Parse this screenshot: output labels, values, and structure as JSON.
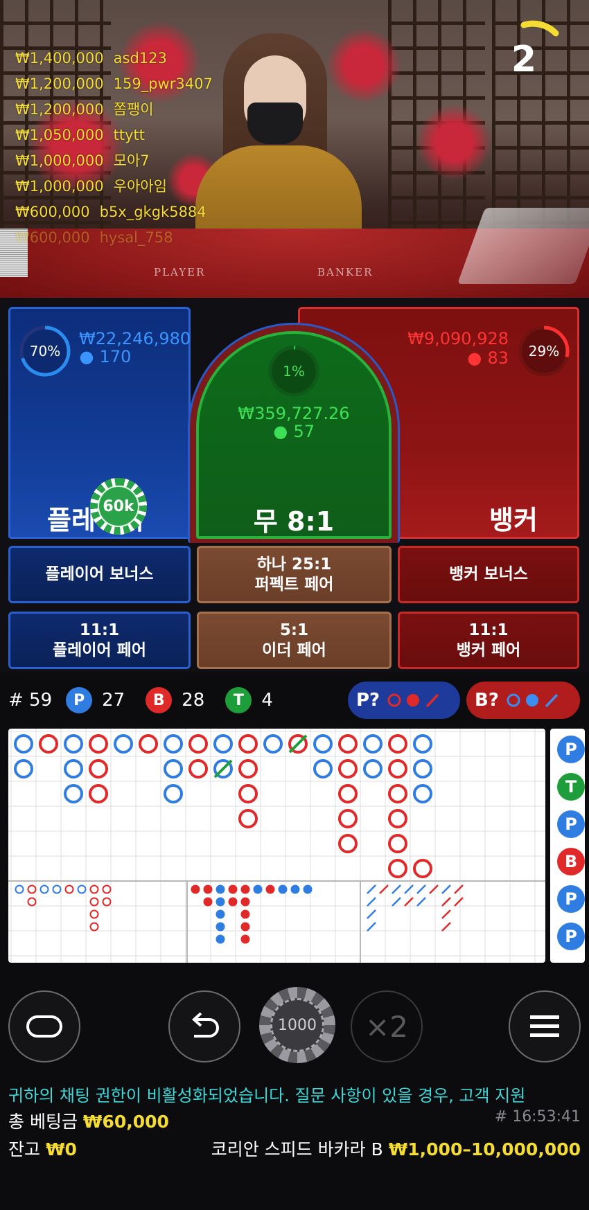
{
  "video": {
    "table_player_label": "PLAYER",
    "table_banker_label": "BANKER",
    "countdown": "2",
    "bet_feed": [
      {
        "amount": "₩1,400,000",
        "user": "asd123"
      },
      {
        "amount": "₩1,200,000",
        "user": "159_pwr3407"
      },
      {
        "amount": "₩1,200,000",
        "user": "쫌팽이"
      },
      {
        "amount": "₩1,050,000",
        "user": "ttytt"
      },
      {
        "amount": "₩1,000,000",
        "user": "모아7"
      },
      {
        "amount": "₩1,000,000",
        "user": "우아아임"
      },
      {
        "amount": "₩600,000",
        "user": "b5x_gkgk5884"
      },
      {
        "amount": "₩600,000",
        "user": "hysal_758"
      }
    ]
  },
  "zones": {
    "player": {
      "percent": "70%",
      "percent_value": 0.7,
      "amount": "₩22,246,980",
      "players": "170",
      "label": "플레이어",
      "color": "#2b8cf0"
    },
    "tie": {
      "percent": "1%",
      "percent_value": 0.01,
      "amount": "₩359,727.26",
      "players": "57",
      "label": "무 8:1",
      "color": "#2fd34a"
    },
    "banker": {
      "percent": "29%",
      "percent_value": 0.29,
      "amount": "₩9,090,928",
      "players": "83",
      "label": "뱅커",
      "color": "#ff3030"
    },
    "chip": "60k"
  },
  "side_bets": {
    "player_bonus": "플레이어 보너스",
    "perfect_pair_line1": "하나 25:1",
    "perfect_pair_line2": "퍼펙트 페어",
    "banker_bonus": "뱅커 보너스",
    "player_pair_line1": "11:1",
    "player_pair_line2": "플레이어 페어",
    "either_pair_line1": "5:1",
    "either_pair_line2": "이더 페어",
    "banker_pair_line1": "11:1",
    "banker_pair_line2": "뱅커 페어"
  },
  "stats": {
    "round": "# 59",
    "p_label": "P",
    "p_count": "27",
    "b_label": "B",
    "b_count": "28",
    "t_label": "T",
    "t_count": "4",
    "p_predict": "P?",
    "b_predict": "B?",
    "colors": {
      "player": "#2f7de0",
      "banker": "#e02a2a",
      "tie": "#1e9e3a"
    }
  },
  "roadmap": {
    "big_road": [
      {
        "col": 0,
        "row": 0,
        "c": "B"
      },
      {
        "col": 0,
        "row": 1,
        "c": "B"
      },
      {
        "col": 1,
        "row": 0,
        "c": "R"
      },
      {
        "col": 2,
        "row": 0,
        "c": "B"
      },
      {
        "col": 2,
        "row": 1,
        "c": "B"
      },
      {
        "col": 2,
        "row": 2,
        "c": "B"
      },
      {
        "col": 3,
        "row": 0,
        "c": "R"
      },
      {
        "col": 3,
        "row": 1,
        "c": "R"
      },
      {
        "col": 3,
        "row": 2,
        "c": "R"
      },
      {
        "col": 4,
        "row": 0,
        "c": "B"
      },
      {
        "col": 5,
        "row": 0,
        "c": "R"
      },
      {
        "col": 6,
        "row": 0,
        "c": "B"
      },
      {
        "col": 6,
        "row": 1,
        "c": "B"
      },
      {
        "col": 6,
        "row": 2,
        "c": "B"
      },
      {
        "col": 7,
        "row": 0,
        "c": "R"
      },
      {
        "col": 7,
        "row": 1,
        "c": "R"
      },
      {
        "col": 8,
        "row": 0,
        "c": "B"
      },
      {
        "col": 8,
        "row": 1,
        "c": "B",
        "tie": true
      },
      {
        "col": 9,
        "row": 0,
        "c": "R"
      },
      {
        "col": 9,
        "row": 1,
        "c": "R"
      },
      {
        "col": 9,
        "row": 2,
        "c": "R"
      },
      {
        "col": 9,
        "row": 3,
        "c": "R"
      },
      {
        "col": 10,
        "row": 0,
        "c": "B"
      },
      {
        "col": 11,
        "row": 0,
        "c": "R",
        "tie": true
      },
      {
        "col": 12,
        "row": 0,
        "c": "B"
      },
      {
        "col": 12,
        "row": 1,
        "c": "B"
      },
      {
        "col": 13,
        "row": 0,
        "c": "R"
      },
      {
        "col": 13,
        "row": 1,
        "c": "R"
      },
      {
        "col": 13,
        "row": 2,
        "c": "R"
      },
      {
        "col": 13,
        "row": 3,
        "c": "R"
      },
      {
        "col": 13,
        "row": 4,
        "c": "R"
      },
      {
        "col": 14,
        "row": 0,
        "c": "B"
      },
      {
        "col": 14,
        "row": 1,
        "c": "B"
      },
      {
        "col": 15,
        "row": 0,
        "c": "R"
      },
      {
        "col": 15,
        "row": 1,
        "c": "R"
      },
      {
        "col": 15,
        "row": 2,
        "c": "R"
      },
      {
        "col": 15,
        "row": 3,
        "c": "R"
      },
      {
        "col": 15,
        "row": 4,
        "c": "R"
      },
      {
        "col": 15,
        "row": 5,
        "c": "R"
      },
      {
        "col": 16,
        "row": 0,
        "c": "B"
      },
      {
        "col": 16,
        "row": 1,
        "c": "B"
      },
      {
        "col": 16,
        "row": 2,
        "c": "B"
      },
      {
        "col": 16,
        "row": 5,
        "c": "R"
      }
    ],
    "big_eye": [
      {
        "col": 0,
        "row": 0,
        "c": "B"
      },
      {
        "col": 1,
        "row": 0,
        "c": "R"
      },
      {
        "col": 1,
        "row": 1,
        "c": "R"
      },
      {
        "col": 2,
        "row": 0,
        "c": "B"
      },
      {
        "col": 3,
        "row": 0,
        "c": "B"
      },
      {
        "col": 4,
        "row": 0,
        "c": "R"
      },
      {
        "col": 5,
        "row": 0,
        "c": "B"
      },
      {
        "col": 6,
        "row": 0,
        "c": "R"
      },
      {
        "col": 6,
        "row": 1,
        "c": "R"
      },
      {
        "col": 6,
        "row": 2,
        "c": "R"
      },
      {
        "col": 6,
        "row": 3,
        "c": "R"
      },
      {
        "col": 7,
        "row": 0,
        "c": "R"
      },
      {
        "col": 7,
        "row": 1,
        "c": "R"
      }
    ],
    "small": [
      {
        "col": 0,
        "row": 0,
        "c": "R"
      },
      {
        "col": 1,
        "row": 0,
        "c": "R"
      },
      {
        "col": 1,
        "row": 1,
        "c": "R"
      },
      {
        "col": 2,
        "row": 0,
        "c": "B"
      },
      {
        "col": 2,
        "row": 1,
        "c": "B"
      },
      {
        "col": 2,
        "row": 2,
        "c": "B"
      },
      {
        "col": 2,
        "row": 3,
        "c": "B"
      },
      {
        "col": 2,
        "row": 4,
        "c": "B"
      },
      {
        "col": 3,
        "row": 0,
        "c": "R"
      },
      {
        "col": 3,
        "row": 1,
        "c": "R"
      },
      {
        "col": 4,
        "row": 0,
        "c": "R"
      },
      {
        "col": 4,
        "row": 1,
        "c": "R"
      },
      {
        "col": 4,
        "row": 2,
        "c": "R"
      },
      {
        "col": 4,
        "row": 3,
        "c": "R"
      },
      {
        "col": 4,
        "row": 4,
        "c": "R"
      },
      {
        "col": 5,
        "row": 0,
        "c": "B"
      },
      {
        "col": 6,
        "row": 0,
        "c": "R"
      },
      {
        "col": 7,
        "row": 0,
        "c": "B"
      },
      {
        "col": 8,
        "row": 0,
        "c": "B"
      },
      {
        "col": 9,
        "row": 0,
        "c": "B"
      }
    ],
    "cockroach": [
      {
        "col": 0,
        "row": 0,
        "c": "B"
      },
      {
        "col": 0,
        "row": 1,
        "c": "B"
      },
      {
        "col": 0,
        "row": 2,
        "c": "B"
      },
      {
        "col": 0,
        "row": 3,
        "c": "B"
      },
      {
        "col": 1,
        "row": 0,
        "c": "R"
      },
      {
        "col": 2,
        "row": 0,
        "c": "B"
      },
      {
        "col": 2,
        "row": 1,
        "c": "B"
      },
      {
        "col": 3,
        "row": 0,
        "c": "B"
      },
      {
        "col": 3,
        "row": 1,
        "c": "R"
      },
      {
        "col": 4,
        "row": 0,
        "c": "B"
      },
      {
        "col": 4,
        "row": 1,
        "c": "B"
      },
      {
        "col": 5,
        "row": 0,
        "c": "R"
      },
      {
        "col": 6,
        "row": 0,
        "c": "B"
      },
      {
        "col": 6,
        "row": 1,
        "c": "R"
      },
      {
        "col": 6,
        "row": 2,
        "c": "R"
      },
      {
        "col": 6,
        "row": 3,
        "c": "R"
      },
      {
        "col": 7,
        "row": 0,
        "c": "R"
      },
      {
        "col": 7,
        "row": 1,
        "c": "R"
      }
    ],
    "side_column": [
      "P",
      "T",
      "P",
      "B",
      "P",
      "P"
    ]
  },
  "controls": {
    "chip_value": "1000",
    "double": "×2"
  },
  "footer": {
    "chat_notice": "귀하의 채팅 권한이 비활성화되었습니다. 질문 사항이 있을 경우, 고객 지원",
    "total_bet_label": "총 베팅금",
    "total_bet_value": "₩60,000",
    "time": "# 16:53:41",
    "balance_label": "잔고",
    "balance_value": "₩0",
    "table_name": "코리안 스피드 바카라 B",
    "limits": "₩1,000–10,000,000"
  }
}
